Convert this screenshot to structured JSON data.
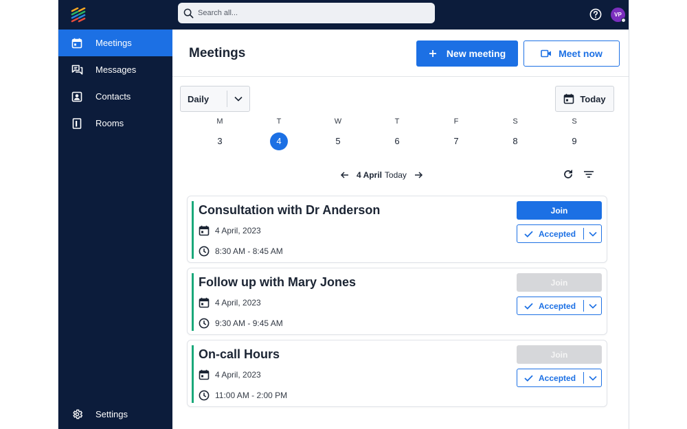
{
  "topbar": {
    "search_placeholder": "Search all...",
    "avatar_initials": "VP"
  },
  "sidebar": {
    "items": [
      {
        "label": "Meetings",
        "icon": "calendar-icon"
      },
      {
        "label": "Messages",
        "icon": "chat-icon"
      },
      {
        "label": "Contacts",
        "icon": "contact-card-icon"
      },
      {
        "label": "Rooms",
        "icon": "door-icon"
      }
    ],
    "settings_label": "Settings"
  },
  "header": {
    "title": "Meetings",
    "new_meeting_label": "New meeting",
    "meet_now_label": "Meet now"
  },
  "calendar": {
    "view_value": "Daily",
    "today_label": "Today",
    "week": [
      {
        "letter": "M",
        "num": "3"
      },
      {
        "letter": "T",
        "num": "4"
      },
      {
        "letter": "W",
        "num": "5"
      },
      {
        "letter": "T",
        "num": "6"
      },
      {
        "letter": "F",
        "num": "7"
      },
      {
        "letter": "S",
        "num": "8"
      },
      {
        "letter": "S",
        "num": "9"
      }
    ],
    "selected_index": 1,
    "current_date": "4 April",
    "current_date_suffix": "Today"
  },
  "meetings": [
    {
      "title": "Consultation with Dr Anderson",
      "date": "4 April, 2023",
      "time": "8:30 AM - 8:45 AM",
      "join_label": "Join",
      "join_enabled": true,
      "status": "Accepted"
    },
    {
      "title": "Follow up with Mary Jones",
      "date": "4 April, 2023",
      "time": "9:30 AM - 9:45 AM",
      "join_label": "Join",
      "join_enabled": false,
      "status": "Accepted"
    },
    {
      "title": "On-call Hours",
      "date": "4 April, 2023",
      "time": "11:00 AM - 2:00 PM",
      "join_label": "Join",
      "join_enabled": false,
      "status": "Accepted"
    }
  ],
  "colors": {
    "brand_navy": "#0c1c3b",
    "accent_blue": "#1c70e4",
    "meeting_bar_green": "#1aa87a",
    "avatar_purple": "#7b2fbe"
  }
}
